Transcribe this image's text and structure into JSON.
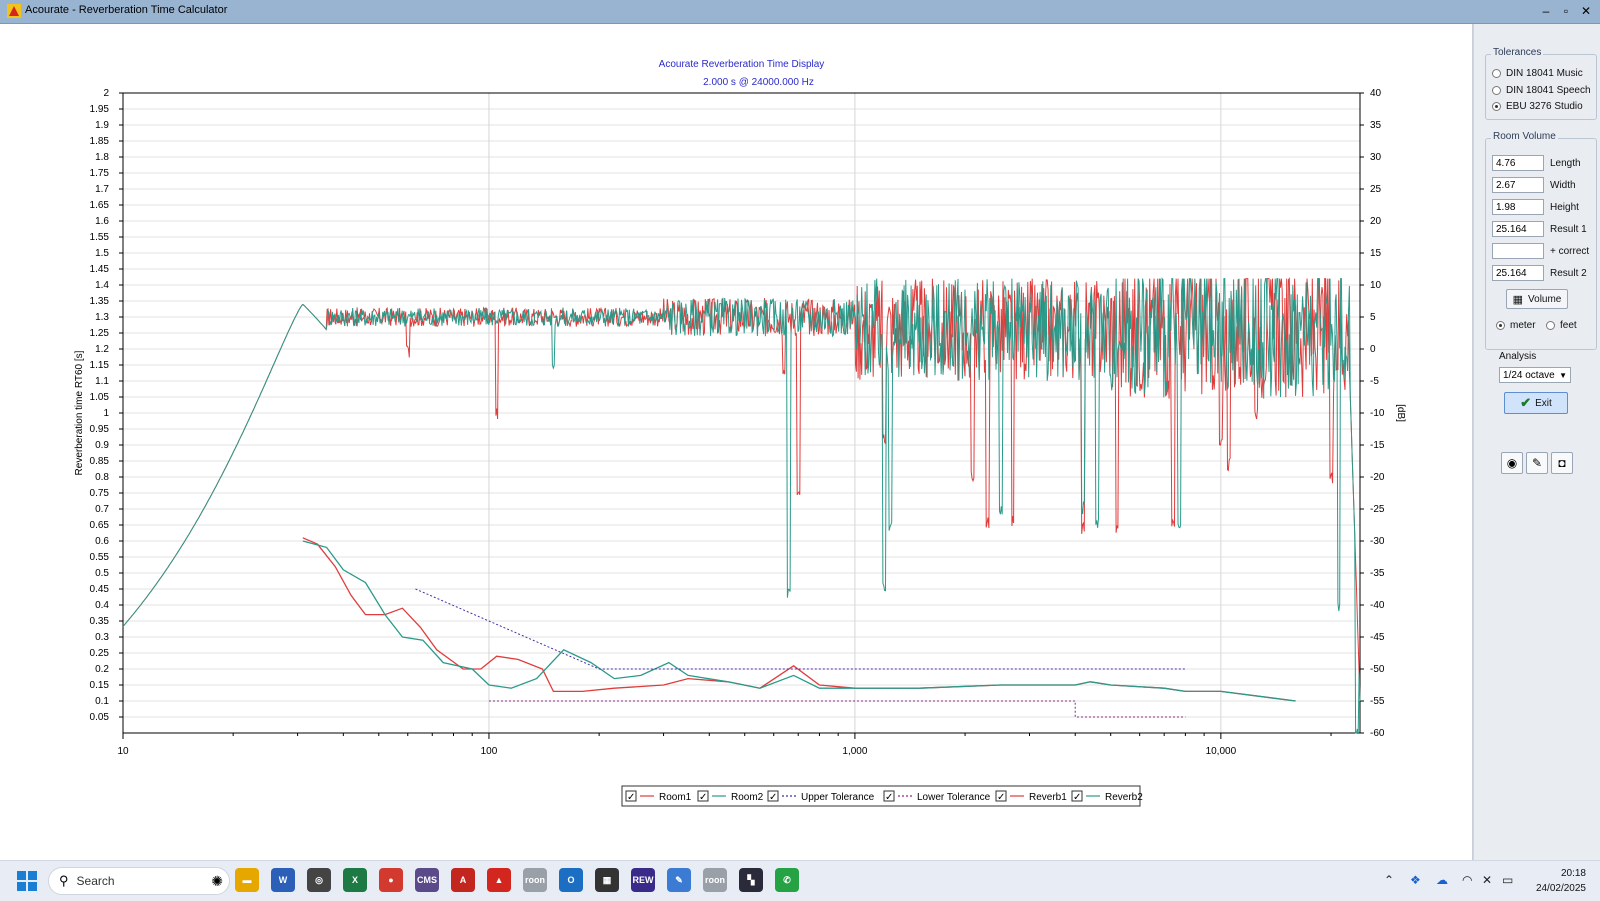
{
  "window": {
    "title": "Acourate - Reverberation Time Calculator",
    "controls": [
      "–",
      "▫",
      "✕"
    ]
  },
  "chart_data": {
    "type": "line",
    "title": "Acourate Reverberation Time Display",
    "subtitle": "2.000 s @ 24000.000 Hz",
    "ylabel": "Reverberation time RT60 [s]",
    "y2label": "[dB]",
    "xscale": "log",
    "xlim": [
      10,
      24000
    ],
    "ylim": [
      0,
      2
    ],
    "y2lim": [
      -60,
      40
    ],
    "grid": true,
    "legend_position": "bottom-center",
    "xticks": [
      {
        "v": 10,
        "label": "10"
      },
      {
        "v": 100,
        "label": "100"
      },
      {
        "v": 1000,
        "label": "1,000"
      },
      {
        "v": 10000,
        "label": "10,000"
      }
    ],
    "yticks": [
      "0.05",
      "0.1",
      "0.15",
      "0.2",
      "0.25",
      "0.3",
      "0.35",
      "0.4",
      "0.45",
      "0.5",
      "0.55",
      "0.6",
      "0.65",
      "0.7",
      "0.75",
      "0.8",
      "0.85",
      "0.9",
      "0.95",
      "1",
      "1.05",
      "1.1",
      "1.15",
      "1.2",
      "1.25",
      "1.3",
      "1.35",
      "1.4",
      "1.45",
      "1.5",
      "1.55",
      "1.6",
      "1.65",
      "1.7",
      "1.75",
      "1.8",
      "1.85",
      "1.9",
      "1.95",
      "2"
    ],
    "y2ticks": [
      "40",
      "35",
      "30",
      "25",
      "20",
      "15",
      "10",
      "5",
      "0",
      "-5",
      "-10",
      "-15",
      "-20",
      "-25",
      "-30",
      "-35",
      "-40",
      "-45",
      "-50",
      "-55",
      "-60"
    ],
    "legend": [
      {
        "name": "Room1",
        "color": "#e03c3c",
        "dash": false
      },
      {
        "name": "Room2",
        "color": "#2a9a8a",
        "dash": false
      },
      {
        "name": "Upper Tolerance",
        "color": "#4b2aa8",
        "dash": true
      },
      {
        "name": "Lower Tolerance",
        "color": "#8a2a8a",
        "dash": true
      },
      {
        "name": "Reverb1",
        "color": "#e03c3c",
        "dash": false
      },
      {
        "name": "Reverb2",
        "color": "#2a9a8a",
        "dash": false
      }
    ],
    "series": [
      {
        "name": "Reverb1",
        "axis": "rt60",
        "color": "#e03c3c",
        "points": [
          [
            31,
            0.61
          ],
          [
            34,
            0.59
          ],
          [
            38,
            0.52
          ],
          [
            42,
            0.43
          ],
          [
            46,
            0.37
          ],
          [
            52,
            0.37
          ],
          [
            58,
            0.39
          ],
          [
            65,
            0.33
          ],
          [
            72,
            0.26
          ],
          [
            85,
            0.2
          ],
          [
            95,
            0.2
          ],
          [
            105,
            0.24
          ],
          [
            120,
            0.23
          ],
          [
            140,
            0.2
          ],
          [
            150,
            0.13
          ],
          [
            180,
            0.13
          ],
          [
            220,
            0.14
          ],
          [
            300,
            0.15
          ],
          [
            350,
            0.17
          ],
          [
            450,
            0.16
          ],
          [
            550,
            0.14
          ],
          [
            680,
            0.21
          ],
          [
            800,
            0.15
          ],
          [
            1000,
            0.14
          ],
          [
            1500,
            0.14
          ],
          [
            2500,
            0.15
          ],
          [
            4000,
            0.15
          ],
          [
            4400,
            0.16
          ],
          [
            5000,
            0.15
          ],
          [
            7000,
            0.14
          ],
          [
            8000,
            0.13
          ],
          [
            10000,
            0.13
          ],
          [
            16000,
            0.1
          ]
        ]
      },
      {
        "name": "Reverb2",
        "axis": "rt60",
        "color": "#2a9a8a",
        "points": [
          [
            31,
            0.6
          ],
          [
            36,
            0.58
          ],
          [
            40,
            0.51
          ],
          [
            46,
            0.47
          ],
          [
            52,
            0.37
          ],
          [
            58,
            0.3
          ],
          [
            66,
            0.29
          ],
          [
            75,
            0.22
          ],
          [
            90,
            0.2
          ],
          [
            100,
            0.15
          ],
          [
            115,
            0.14
          ],
          [
            135,
            0.17
          ],
          [
            160,
            0.26
          ],
          [
            190,
            0.22
          ],
          [
            220,
            0.17
          ],
          [
            260,
            0.18
          ],
          [
            310,
            0.22
          ],
          [
            350,
            0.18
          ],
          [
            450,
            0.16
          ],
          [
            550,
            0.14
          ],
          [
            680,
            0.18
          ],
          [
            800,
            0.14
          ],
          [
            1000,
            0.14
          ],
          [
            1500,
            0.14
          ],
          [
            2500,
            0.15
          ],
          [
            4000,
            0.15
          ],
          [
            4400,
            0.16
          ],
          [
            5000,
            0.15
          ],
          [
            7000,
            0.14
          ],
          [
            8000,
            0.13
          ],
          [
            10000,
            0.13
          ],
          [
            16000,
            0.1
          ]
        ]
      },
      {
        "name": "Upper Tolerance",
        "axis": "rt60",
        "color": "#4b2aa8",
        "dash": true,
        "points": [
          [
            63,
            0.45
          ],
          [
            200,
            0.2
          ],
          [
            8000,
            0.2
          ]
        ]
      },
      {
        "name": "Lower Tolerance",
        "axis": "rt60",
        "color": "#8a2a8a",
        "dash": true,
        "points": [
          [
            100,
            0.1
          ],
          [
            4000,
            0.1
          ],
          [
            4000,
            0.05
          ],
          [
            8000,
            0.05
          ]
        ]
      },
      {
        "name": "Room1",
        "axis": "db",
        "color": "#e03c3c",
        "noise_amp": [
          2.5,
          5,
          9,
          12
        ],
        "dips": [
          [
            60,
            -0.5
          ],
          [
            105,
            -10
          ],
          [
            640,
            -3
          ],
          [
            700,
            -23
          ],
          [
            1200,
            -14
          ],
          [
            2100,
            -20
          ],
          [
            2300,
            -27
          ],
          [
            2700,
            -27
          ],
          [
            4200,
            -28
          ],
          [
            5200,
            -28
          ],
          [
            7400,
            -27
          ],
          [
            10000,
            -15
          ],
          [
            10500,
            -18
          ],
          [
            12500,
            -10
          ],
          [
            20000,
            -20
          ]
        ]
      },
      {
        "name": "Room2",
        "axis": "db",
        "color": "#2a9a8a",
        "noise_amp": [
          2.5,
          5,
          9,
          12
        ],
        "dips": [
          [
            150,
            -3
          ],
          [
            660,
            -38
          ],
          [
            1200,
            -37
          ],
          [
            1250,
            -28
          ],
          [
            2500,
            -25
          ],
          [
            4200,
            -25
          ],
          [
            4600,
            -27
          ],
          [
            7700,
            -28
          ],
          [
            21000,
            -40
          ],
          [
            23500,
            -60
          ]
        ]
      }
    ]
  },
  "right_panel": {
    "tolerances": {
      "title": "Tolerances",
      "options": [
        {
          "label": "DIN 18041 Music",
          "selected": false
        },
        {
          "label": "DIN 18041 Speech",
          "selected": false
        },
        {
          "label": "EBU 3276 Studio",
          "selected": true
        }
      ]
    },
    "room_volume": {
      "title": "Room Volume",
      "fields": [
        {
          "value": "4.76",
          "label": "Length"
        },
        {
          "value": "2.67",
          "label": "Width"
        },
        {
          "value": "1.98",
          "label": "Height"
        },
        {
          "value": "25.164",
          "label": "Result 1"
        },
        {
          "value": "",
          "label": "+ correct"
        },
        {
          "value": "25.164",
          "label": "Result 2"
        }
      ],
      "volume_button": "Volume",
      "units": [
        {
          "label": "meter",
          "selected": true
        },
        {
          "label": "feet",
          "selected": false
        }
      ]
    },
    "analysis": {
      "label": "Analysis",
      "value": "1/24 octave"
    },
    "exit_button": "Exit"
  },
  "taskbar": {
    "search_placeholder": "Search",
    "apps": [
      {
        "name": "file-explorer",
        "color": "#e6a700",
        "glyph": "▬"
      },
      {
        "name": "word",
        "color": "#2b5fb8",
        "glyph": "W"
      },
      {
        "name": "search-tool",
        "color": "#444444",
        "glyph": "◎"
      },
      {
        "name": "excel",
        "color": "#1d7a45",
        "glyph": "X"
      },
      {
        "name": "chrome",
        "color": "#d23a2f",
        "glyph": "●"
      },
      {
        "name": "cms",
        "color": "#5a4a8a",
        "glyph": "CMS"
      },
      {
        "name": "acrobat",
        "color": "#c3261f",
        "glyph": "A"
      },
      {
        "name": "acourate",
        "color": "#d3261f",
        "glyph": "▲"
      },
      {
        "name": "roon1",
        "color": "#9aa0a8",
        "glyph": "roon"
      },
      {
        "name": "outlook",
        "color": "#1b6ec2",
        "glyph": "O"
      },
      {
        "name": "rew-grid",
        "color": "#333333",
        "glyph": "▦"
      },
      {
        "name": "rew",
        "color": "#3a2a8a",
        "glyph": "REW"
      },
      {
        "name": "whiteboard",
        "color": "#3b7bd4",
        "glyph": "✎"
      },
      {
        "name": "roon2",
        "color": "#9aa0a8",
        "glyph": "roon"
      },
      {
        "name": "sqz",
        "color": "#2a2a3a",
        "glyph": "▚"
      },
      {
        "name": "whatsapp",
        "color": "#25a244",
        "glyph": "✆"
      }
    ],
    "time": "20:18",
    "date": "24/02/2025"
  }
}
